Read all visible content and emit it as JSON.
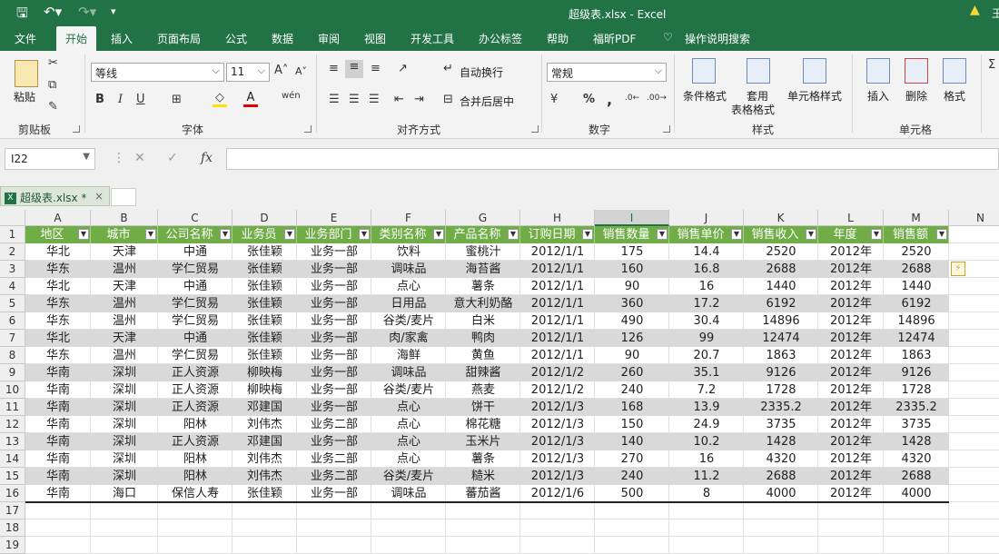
{
  "window": {
    "title": "超级表.xlsx  -  Excel",
    "user_initial": "王"
  },
  "ribbon_tabs": [
    "文件",
    "开始",
    "插入",
    "页面布局",
    "公式",
    "数据",
    "审阅",
    "视图",
    "开发工具",
    "办公标签",
    "帮助",
    "福昕PDF",
    "操作说明搜索"
  ],
  "ribbon": {
    "clipboard": {
      "paste_label": "粘贴",
      "group_label": "剪贴板"
    },
    "font": {
      "name": "等线",
      "size": "11",
      "group_label": "字体",
      "bold": "B",
      "italic": "I",
      "underline": "U"
    },
    "alignment": {
      "wrap_label": "自动换行",
      "merge_label": "合并后居中",
      "group_label": "对齐方式"
    },
    "number": {
      "format": "常规",
      "group_label": "数字",
      "percent": "%",
      "comma": ","
    },
    "styles": {
      "conditional_label": "条件格式",
      "table_label_1": "套用",
      "table_label_2": "表格格式",
      "cell_styles_label": "单元格样式",
      "group_label": "样式"
    },
    "cells": {
      "insert_label": "插入",
      "delete_label": "删除",
      "format_label": "格式",
      "group_label": "单元格"
    }
  },
  "formula_bar": {
    "name_box": "I22",
    "fx": "fx",
    "formula": ""
  },
  "file_tab": {
    "label": "超级表.xlsx *",
    "close": "×"
  },
  "sheet": {
    "col_letters": [
      "A",
      "B",
      "C",
      "D",
      "E",
      "F",
      "G",
      "H",
      "I",
      "J",
      "K",
      "L",
      "M",
      "N"
    ],
    "selected_col": "I",
    "row_numbers": [
      "1",
      "2",
      "3",
      "4",
      "5",
      "6",
      "7",
      "8",
      "9",
      "10",
      "11",
      "12",
      "13",
      "14",
      "15",
      "16",
      "17",
      "18",
      "19"
    ],
    "headers": [
      "地区",
      "城市",
      "公司名称",
      "业务员",
      "业务部门",
      "类别名称",
      "产品名称",
      "订购日期",
      "销售数量",
      "销售单价",
      "销售收入",
      "年度",
      "销售额"
    ],
    "rows": [
      [
        "华北",
        "天津",
        "中通",
        "张佳颖",
        "业务一部",
        "饮料",
        "蜜桃汁",
        "2012/1/1",
        "175",
        "14.4",
        "2520",
        "2012年",
        "2520"
      ],
      [
        "华东",
        "温州",
        "学仁贸易",
        "张佳颖",
        "业务一部",
        "调味品",
        "海苔酱",
        "2012/1/1",
        "160",
        "16.8",
        "2688",
        "2012年",
        "2688"
      ],
      [
        "华北",
        "天津",
        "中通",
        "张佳颖",
        "业务一部",
        "点心",
        "薯条",
        "2012/1/1",
        "90",
        "16",
        "1440",
        "2012年",
        "1440"
      ],
      [
        "华东",
        "温州",
        "学仁贸易",
        "张佳颖",
        "业务一部",
        "日用品",
        "意大利奶酪",
        "2012/1/1",
        "360",
        "17.2",
        "6192",
        "2012年",
        "6192"
      ],
      [
        "华东",
        "温州",
        "学仁贸易",
        "张佳颖",
        "业务一部",
        "谷类/麦片",
        "白米",
        "2012/1/1",
        "490",
        "30.4",
        "14896",
        "2012年",
        "14896"
      ],
      [
        "华北",
        "天津",
        "中通",
        "张佳颖",
        "业务一部",
        "肉/家禽",
        "鸭肉",
        "2012/1/1",
        "126",
        "99",
        "12474",
        "2012年",
        "12474"
      ],
      [
        "华东",
        "温州",
        "学仁贸易",
        "张佳颖",
        "业务一部",
        "海鲜",
        "黄鱼",
        "2012/1/1",
        "90",
        "20.7",
        "1863",
        "2012年",
        "1863"
      ],
      [
        "华南",
        "深圳",
        "正人资源",
        "柳映梅",
        "业务一部",
        "调味品",
        "甜辣酱",
        "2012/1/2",
        "260",
        "35.1",
        "9126",
        "2012年",
        "9126"
      ],
      [
        "华南",
        "深圳",
        "正人资源",
        "柳映梅",
        "业务一部",
        "谷类/麦片",
        "燕麦",
        "2012/1/2",
        "240",
        "7.2",
        "1728",
        "2012年",
        "1728"
      ],
      [
        "华南",
        "深圳",
        "正人资源",
        "邓建国",
        "业务一部",
        "点心",
        "饼干",
        "2012/1/3",
        "168",
        "13.9",
        "2335.2",
        "2012年",
        "2335.2"
      ],
      [
        "华南",
        "深圳",
        "阳林",
        "刘伟杰",
        "业务二部",
        "点心",
        "棉花糖",
        "2012/1/3",
        "150",
        "24.9",
        "3735",
        "2012年",
        "3735"
      ],
      [
        "华南",
        "深圳",
        "正人资源",
        "邓建国",
        "业务一部",
        "点心",
        "玉米片",
        "2012/1/3",
        "140",
        "10.2",
        "1428",
        "2012年",
        "1428"
      ],
      [
        "华南",
        "深圳",
        "阳林",
        "刘伟杰",
        "业务二部",
        "点心",
        "薯条",
        "2012/1/3",
        "270",
        "16",
        "4320",
        "2012年",
        "4320"
      ],
      [
        "华南",
        "深圳",
        "阳林",
        "刘伟杰",
        "业务二部",
        "谷类/麦片",
        "糙米",
        "2012/1/3",
        "240",
        "11.2",
        "2688",
        "2012年",
        "2688"
      ],
      [
        "华南",
        "海口",
        "保信人寿",
        "张佳颖",
        "业务一部",
        "调味品",
        "蕃茄酱",
        "2012/1/6",
        "500",
        "8",
        "4000",
        "2012年",
        "4000"
      ]
    ]
  },
  "colors": {
    "accent": "#217346",
    "header_fill": "#70ad47",
    "band_fill": "#d9d9d9"
  }
}
